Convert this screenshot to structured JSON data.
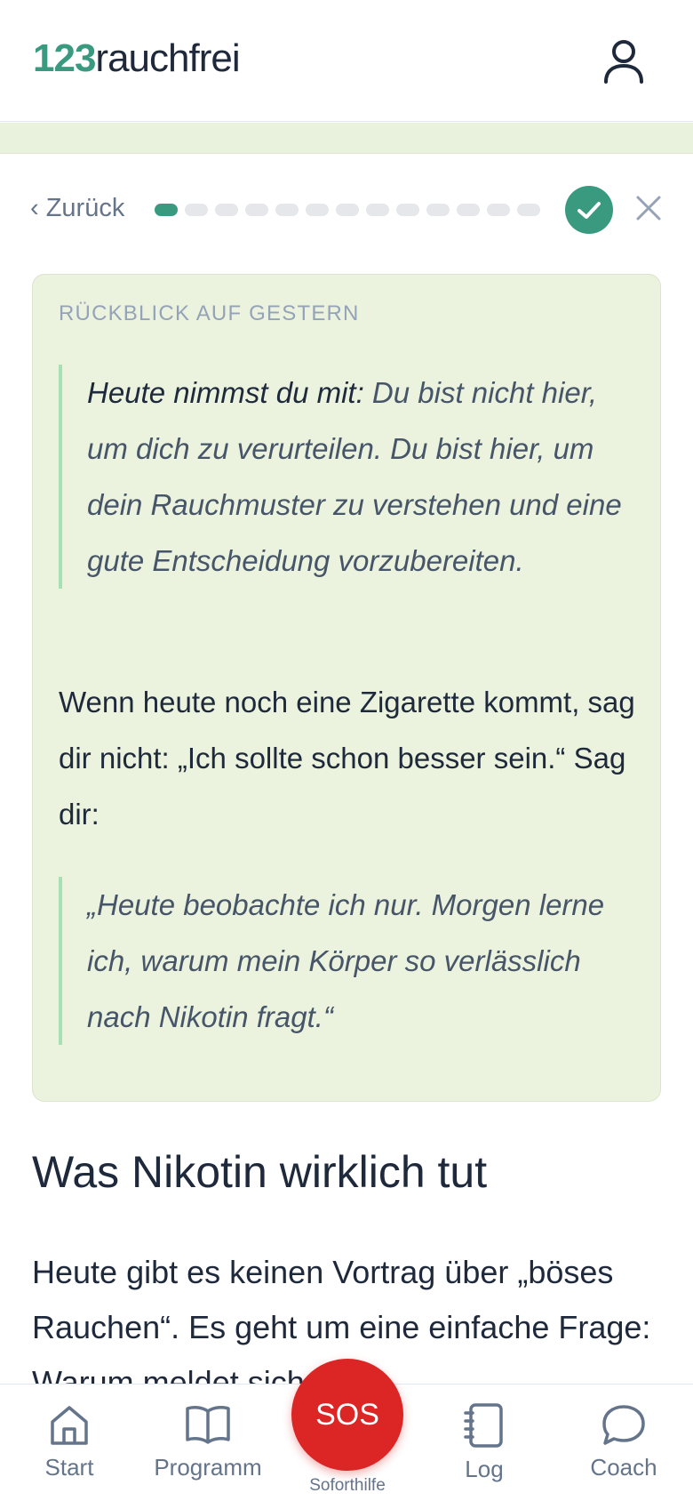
{
  "header": {
    "logo_number": "123",
    "logo_text": "rauchfrei",
    "user_icon": "user-icon"
  },
  "topnav": {
    "back_label": "‹ Zurück",
    "progress": {
      "total": 13,
      "current": 1
    },
    "check_icon": "check-icon",
    "close_icon": "close-icon"
  },
  "card": {
    "label": "RÜCKBLICK AUF GESTERN",
    "quote1_lead": "Heute nimmst du mit:",
    "quote1_text": " Du bist nicht hier, um dich zu verurteilen. Du bist hier, um dein Rauchmuster zu verstehen und eine gute Entscheidung vorzubereiten.",
    "paragraph": "Wenn heute noch eine Zigarette kommt, sag dir nicht: „Ich sollte schon besser sein.“ Sag dir:",
    "quote2": "„Heute beobachte ich nur. Morgen lerne ich, warum mein Körper so verlässlich nach Nikotin fragt.“"
  },
  "section": {
    "heading": "Was Nikotin wirklich tut",
    "body": "Heute gibt es keinen Vortrag über „böses Rauchen“. Es geht um eine einfache Frage: Warum meldet sich das"
  },
  "bottom_nav": {
    "items": [
      {
        "label": "Start",
        "icon": "home-icon"
      },
      {
        "label": "Programm",
        "icon": "book-icon"
      },
      {
        "label": "Log",
        "icon": "notebook-icon"
      },
      {
        "label": "Coach",
        "icon": "chat-icon"
      }
    ],
    "sos_label": "SOS",
    "sos_sub": "Soforthilfe"
  },
  "colors": {
    "accent": "#3a9a80",
    "card_bg": "#ebf2de",
    "sos": "#dc2626"
  }
}
